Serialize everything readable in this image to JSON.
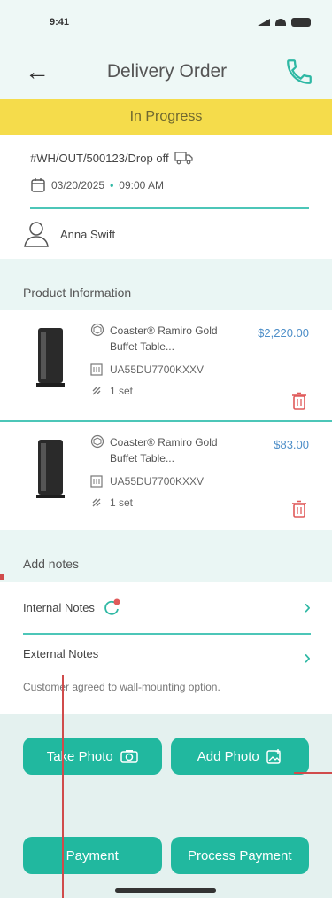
{
  "status_bar": {
    "time": "9:41"
  },
  "header": {
    "title": "Delivery Order"
  },
  "banner": {
    "label": "In Progress"
  },
  "order": {
    "reference": "#WH/OUT/500123/Drop off",
    "date": "03/20/2025",
    "time": "09:00 AM",
    "assignee": "Anna Swift"
  },
  "products_section": {
    "title": "Product Information"
  },
  "products": [
    {
      "name": "Coaster® Ramiro Gold Buffet Table...",
      "sku": "UA55DU7700KXXV",
      "qty": "1 set",
      "price": "$2,220.00"
    },
    {
      "name": "Coaster® Ramiro Gold Buffet Table...",
      "sku": "UA55DU7700KXXV",
      "qty": "1 set",
      "price": "$83.00"
    }
  ],
  "notes_section": {
    "title": "Add notes"
  },
  "notes": {
    "internal_label": "Internal Notes",
    "external_label": "External Notes",
    "external_text": "Customer agreed to wall-mounting option."
  },
  "actions": {
    "take_photo": "Take Photo",
    "add_photo": "Add Photo",
    "payment": "Payment",
    "process_payment": "Process Payment"
  },
  "colors": {
    "accent": "#21b89f",
    "banner": "#f5dc4b",
    "price": "#4d8ec8",
    "delete": "#e05a5a"
  }
}
